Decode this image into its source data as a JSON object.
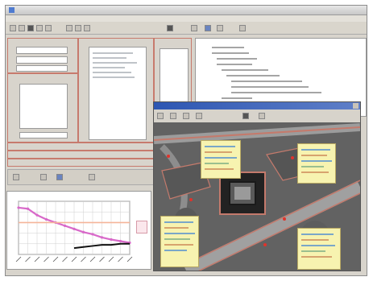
{
  "window": {
    "title": ""
  },
  "menu": {
    "items": [
      "",
      "",
      "",
      "",
      "",
      "",
      "",
      "",
      "",
      ""
    ]
  },
  "panels": {
    "panel_a_title": "",
    "panel_b_title": "",
    "panel_c_title": "",
    "panel_d_title": ""
  },
  "map": {
    "title": ""
  },
  "graph": {
    "title": "",
    "legend": ""
  },
  "colors": {
    "accent_frame": "#c77a6d",
    "map_titlebar": "#2d56b2",
    "note_fill": "#f7f3b0",
    "marker": "#e0332b",
    "series_pink": "#d869c9",
    "series_salmon": "#f5b59a",
    "series_black": "#111111"
  },
  "chart_data": {
    "type": "line",
    "title": "",
    "xlabel": "",
    "ylabel": "",
    "x": [
      1,
      2,
      3,
      4,
      5,
      6,
      7,
      8,
      9,
      10,
      11,
      12,
      13
    ],
    "series": [
      {
        "values": [
          88,
          86,
          74,
          66,
          60,
          54,
          48,
          42,
          38,
          32,
          28,
          25,
          22
        ]
      },
      {
        "values": [
          60,
          60,
          60,
          60,
          60,
          60,
          60,
          60,
          60,
          60,
          60,
          60,
          60
        ]
      },
      {
        "values": [
          null,
          null,
          null,
          null,
          null,
          null,
          12,
          14,
          16,
          18,
          18,
          20,
          20
        ]
      }
    ],
    "ylim": [
      0,
      100
    ],
    "grid": true
  }
}
